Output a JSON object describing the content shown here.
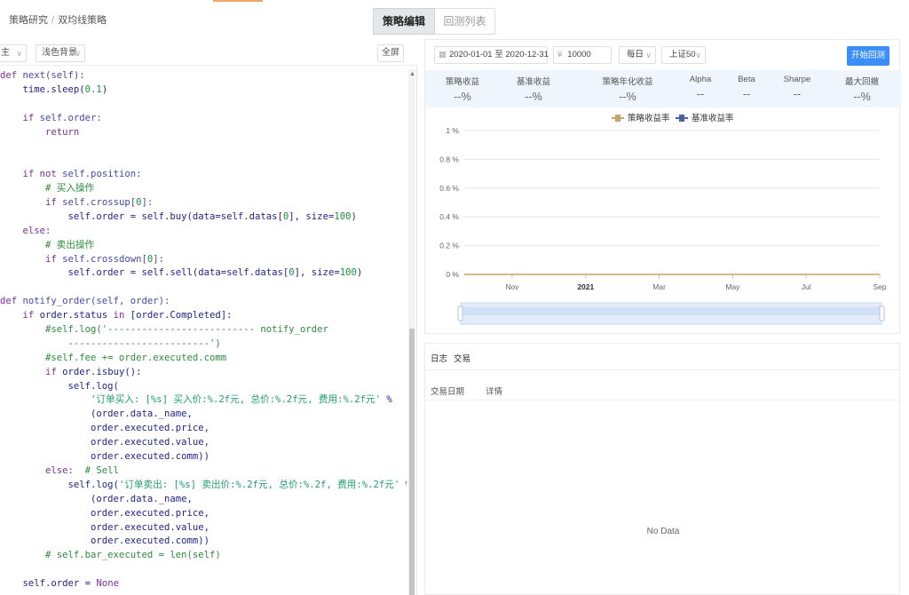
{
  "breadcrumb": {
    "root": "策略研究",
    "separator": "/",
    "current": "双均线策略"
  },
  "tabs": [
    {
      "label": "策略编辑",
      "active": true
    },
    {
      "label": "回测列表",
      "active": false
    }
  ],
  "editor": {
    "select1": "主",
    "select2": "浅色背景",
    "fullscreen_label": "全屏",
    "code_lines": [
      [
        [
          "kw",
          "def "
        ],
        [
          "nm",
          "next(self):"
        ]
      ],
      [
        [
          "",
          "    time.sleep("
        ],
        [
          "num",
          "0.1"
        ],
        [
          "",
          ")"
        ]
      ],
      [
        [
          "",
          ""
        ]
      ],
      [
        [
          "kw",
          "    if "
        ],
        [
          "nm",
          "self.order:"
        ]
      ],
      [
        [
          "kw",
          "        return"
        ]
      ],
      [
        [
          "",
          ""
        ]
      ],
      [
        [
          "",
          ""
        ]
      ],
      [
        [
          "kw",
          "    if not "
        ],
        [
          "nm",
          "self.position:"
        ]
      ],
      [
        [
          "cm",
          "        # 买入操作"
        ]
      ],
      [
        [
          "kw",
          "        if "
        ],
        [
          "nm",
          "self.crossup["
        ],
        [
          "num",
          "0"
        ],
        [
          "nm",
          "]:"
        ]
      ],
      [
        [
          "",
          "            self.order = self.buy(data=self.datas["
        ],
        [
          "num",
          "0"
        ],
        [
          "",
          "], size="
        ],
        [
          "num",
          "100"
        ],
        [
          "",
          ")"
        ]
      ],
      [
        [
          "kw",
          "    else:"
        ]
      ],
      [
        [
          "cm",
          "        # 卖出操作"
        ]
      ],
      [
        [
          "kw",
          "        if "
        ],
        [
          "nm",
          "self.crossdown["
        ],
        [
          "num",
          "0"
        ],
        [
          "nm",
          "]:"
        ]
      ],
      [
        [
          "",
          "            self.order = self.sell(data=self.datas["
        ],
        [
          "num",
          "0"
        ],
        [
          "",
          "], size="
        ],
        [
          "num",
          "100"
        ],
        [
          "",
          ")"
        ]
      ],
      [
        [
          "",
          ""
        ]
      ],
      [
        [
          "kw",
          "def "
        ],
        [
          "nm",
          "notify_order(self, order):"
        ]
      ],
      [
        [
          "kw",
          "    if "
        ],
        [
          "",
          "order.status "
        ],
        [
          "kw",
          "in "
        ],
        [
          "",
          "[order.Completed]:"
        ]
      ],
      [
        [
          "cm",
          "        #self.log('-------------------------- notify_order"
        ]
      ],
      [
        [
          "cm",
          "            -------------------------')"
        ]
      ],
      [
        [
          "cm",
          "        #self.fee += order.executed.comm"
        ]
      ],
      [
        [
          "kw",
          "        if "
        ],
        [
          "",
          "order.isbuy():"
        ]
      ],
      [
        [
          "",
          "            self.log("
        ]
      ],
      [
        [
          "str",
          "                '订单买入: [%s] 买入价:%.2f元, 总价:%.2f元, 费用:%.2f元' "
        ],
        [
          "",
          "%"
        ]
      ],
      [
        [
          "",
          "                (order.data._name,"
        ]
      ],
      [
        [
          "",
          "                order.executed.price,"
        ]
      ],
      [
        [
          "",
          "                order.executed.value,"
        ]
      ],
      [
        [
          "",
          "                order.executed.comm))"
        ]
      ],
      [
        [
          "kw",
          "        else:  "
        ],
        [
          "cm",
          "# Sell"
        ]
      ],
      [
        [
          "",
          "            self.log("
        ],
        [
          "str",
          "'订单卖出: [%s] 卖出价:%.2f元, 总价:%.2f, 费用:%.2f元' "
        ],
        [
          "",
          "%"
        ]
      ],
      [
        [
          "",
          "                (order.data._name,"
        ]
      ],
      [
        [
          "",
          "                order.executed.price,"
        ]
      ],
      [
        [
          "",
          "                order.executed.value,"
        ]
      ],
      [
        [
          "",
          "                order.executed.comm))"
        ]
      ],
      [
        [
          "cm",
          "        # self.bar_executed = len(self)"
        ]
      ],
      [
        [
          "",
          ""
        ]
      ],
      [
        [
          "",
          "    self.order = "
        ],
        [
          "kw",
          "None"
        ]
      ]
    ]
  },
  "backtest": {
    "date_start": "2020-01-01",
    "date_sep": "至",
    "date_end": "2020-12-31",
    "capital_prefix": "¥",
    "capital": "10000",
    "frequency": "每日",
    "benchmark": "上证50",
    "start_button": "开始回测"
  },
  "metrics": [
    {
      "label": "策略收益",
      "value": "--%"
    },
    {
      "label": "基准收益",
      "value": "--%"
    },
    {
      "label": "策略年化收益",
      "value": "--%"
    },
    {
      "label": "Alpha",
      "value": "--"
    },
    {
      "label": "Beta",
      "value": "--"
    },
    {
      "label": "Sharpe",
      "value": "--"
    },
    {
      "label": "最大回撤",
      "value": "--%"
    }
  ],
  "chart_data": {
    "type": "line",
    "legend": [
      "策略收益率",
      "基准收益率"
    ],
    "legend_position": "top-center",
    "y_ticks": [
      "0 %",
      "0.2 %",
      "0.4 %",
      "0.6 %",
      "0.8 %",
      "1 %"
    ],
    "ylim": [
      0,
      1
    ],
    "x_ticks": [
      "Nov",
      "2021",
      "Mar",
      "May",
      "Jul",
      "Sep"
    ],
    "series": [
      {
        "name": "策略收益率",
        "color": "#c9a46a",
        "values": [
          0,
          0,
          0,
          0,
          0,
          0
        ]
      },
      {
        "name": "基准收益率",
        "color": "#4a63a8",
        "values": []
      }
    ],
    "grid": true
  },
  "log": {
    "tabs": [
      "日志",
      "交易"
    ],
    "columns": [
      "交易日期",
      "详情"
    ],
    "empty_text": "No Data"
  }
}
